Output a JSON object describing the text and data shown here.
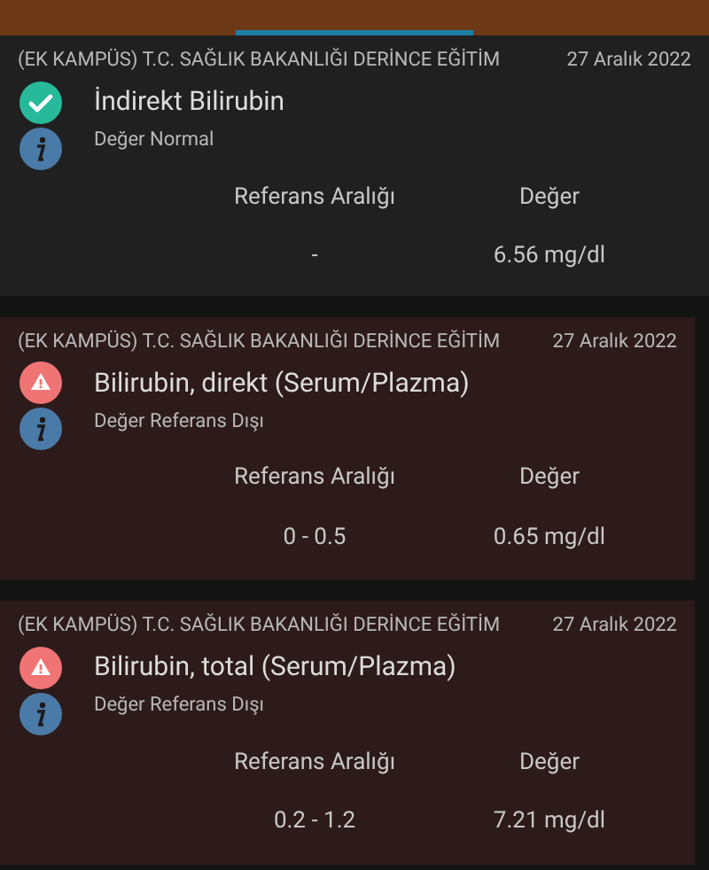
{
  "results": [
    {
      "kind": "normal",
      "institution": "(EK KAMPÜS) T.C. SAĞLIK BAKANLIĞI DERİNCE EĞİTİM",
      "date": "27 Aralık 2022",
      "test": "İndirekt Bilirubin",
      "note": "Değer Normal",
      "range_header": "Referans Aralığı",
      "value_header": "Değer",
      "range": "-",
      "value": "6.56 mg/dl"
    },
    {
      "kind": "abnormal",
      "institution": "(EK KAMPÜS) T.C. SAĞLIK BAKANLIĞI DERİNCE EĞİTİM",
      "date": "27 Aralık 2022",
      "test": "Bilirubin, direkt (Serum/Plazma)",
      "note": "Değer Referans Dışı",
      "range_header": "Referans Aralığı",
      "value_header": "Değer",
      "range": "0 - 0.5",
      "value": "0.65 mg/dl"
    },
    {
      "kind": "abnormal",
      "institution": "(EK KAMPÜS) T.C. SAĞLIK BAKANLIĞI DERİNCE EĞİTİM",
      "date": "27 Aralık 2022",
      "test": "Bilirubin, total (Serum/Plazma)",
      "note": "Değer Referans Dışı",
      "range_header": "Referans Aralığı",
      "value_header": "Değer",
      "range": "0.2 - 1.2",
      "value": "7.21 mg/dl"
    }
  ]
}
